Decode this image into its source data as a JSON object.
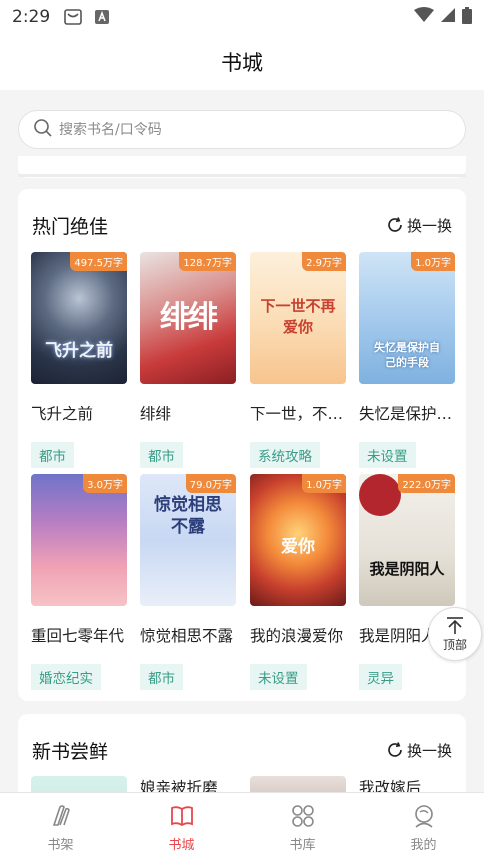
{
  "status_bar": {
    "time": "2:29"
  },
  "header": {
    "title": "书城"
  },
  "search": {
    "placeholder": "搜索书名/口令码"
  },
  "hot_section": {
    "title": "热门绝佳",
    "refresh_label": "换一换",
    "books": [
      {
        "title": "飞升之前",
        "word_count": "497.5万字",
        "tag": "都市",
        "cover_text": "飞升之前"
      },
      {
        "title": "绯绯",
        "word_count": "128.7万字",
        "tag": "都市",
        "cover_text": "绯绯"
      },
      {
        "title": "下一世，不再爱你",
        "word_count": "2.9万字",
        "tag": "系统攻略",
        "cover_text": "下一世不再爱你"
      },
      {
        "title": "失忆是保护自己的手段",
        "word_count": "1.0万字",
        "tag": "未设置",
        "cover_text": "失忆是保护自己的手段"
      },
      {
        "title": "重回七零年代",
        "word_count": "3.0万字",
        "tag": "婚恋纪实",
        "cover_text": ""
      },
      {
        "title": "惊觉相思不露",
        "word_count": "79.0万字",
        "tag": "都市",
        "cover_text": "惊觉相思不露"
      },
      {
        "title": "我的浪漫爱你",
        "word_count": "1.0万字",
        "tag": "未设置",
        "cover_text": "爱你"
      },
      {
        "title": "我是阴阳人",
        "word_count": "222.0万字",
        "tag": "灵异",
        "cover_text": "我是阴阳人"
      }
    ]
  },
  "new_section": {
    "title": "新书尝鲜",
    "refresh_label": "换一换",
    "books": [
      {
        "title": "娘亲被折磨"
      },
      {
        "title": "我改嫁后"
      }
    ]
  },
  "back_to_top": {
    "label": "顶部"
  },
  "tabs": [
    {
      "label": "书架"
    },
    {
      "label": "书城"
    },
    {
      "label": "书库"
    },
    {
      "label": "我的"
    }
  ],
  "colors": {
    "accent": "#e8474b",
    "badge": "#ef8a3c",
    "tag_bg": "#e7f6f3",
    "tag_text": "#3a9c88"
  }
}
